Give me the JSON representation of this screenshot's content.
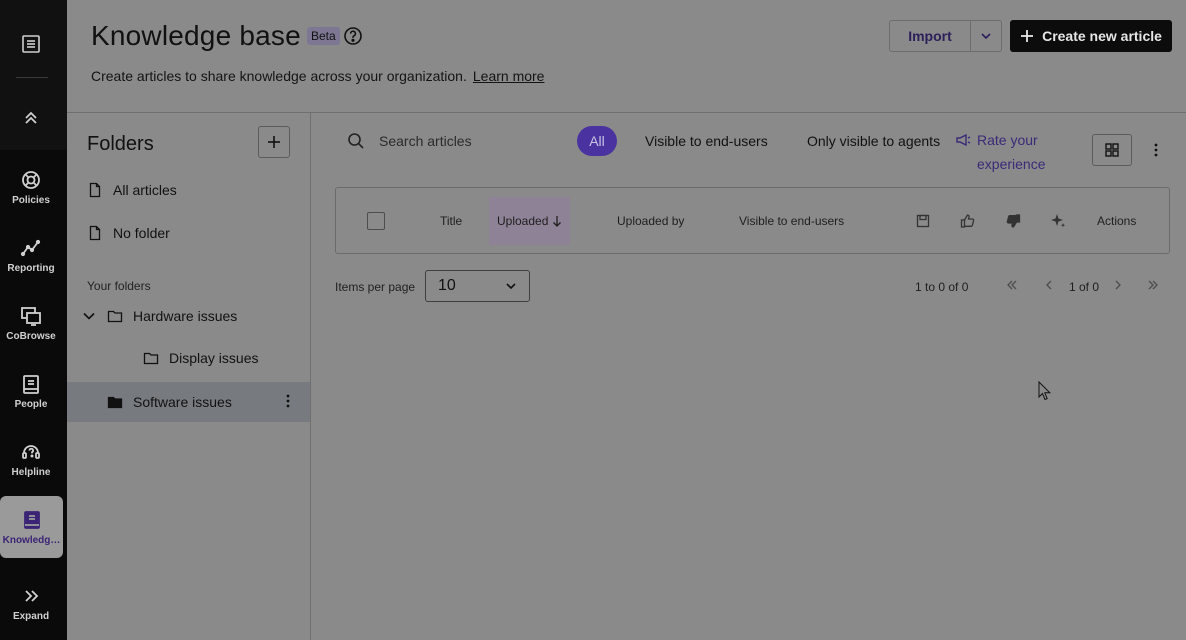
{
  "rail": {
    "items": [
      {
        "label": "Policies",
        "icon": "lifebuoy-icon"
      },
      {
        "label": "Reporting",
        "icon": "chart-line-icon"
      },
      {
        "label": "CoBrowse",
        "icon": "screens-icon"
      },
      {
        "label": "People",
        "icon": "address-book-icon"
      },
      {
        "label": "Helpline",
        "icon": "headset-icon"
      },
      {
        "label": "Knowledg…",
        "icon": "book-icon"
      },
      {
        "label": "Expand",
        "icon": "chevrons-right-icon"
      }
    ],
    "active_color": "#3b2475"
  },
  "header": {
    "title": "Knowledge base",
    "badge": "Beta",
    "subtitle": "Create articles to share knowledge across your organization.",
    "learn_more": "Learn more",
    "import_label": "Import",
    "create_label": "Create new article"
  },
  "folders": {
    "title": "Folders",
    "all_articles": "All articles",
    "no_folder": "No folder",
    "section_label": "Your folders",
    "tree": [
      {
        "label": "Hardware issues",
        "expanded": true
      },
      {
        "label": "Display issues"
      },
      {
        "label": "Software issues",
        "selected": true
      }
    ]
  },
  "main": {
    "search_placeholder": "Search articles",
    "filters": [
      "All",
      "Visible to end-users",
      "Only visible to agents"
    ],
    "rate_line1": "Rate your",
    "rate_line2": "experience",
    "columns": [
      "Title",
      "Uploaded",
      "Uploaded by",
      "Visible to end-users",
      "Actions"
    ],
    "pagination": {
      "items_per_page_label": "Items per page",
      "items_per_page_value": "10",
      "range": "1 to 0 of 0",
      "page": "1 of 0"
    }
  },
  "colors": {
    "accent": "#4a33a0",
    "overlay_bg": "#8a8a8a"
  }
}
